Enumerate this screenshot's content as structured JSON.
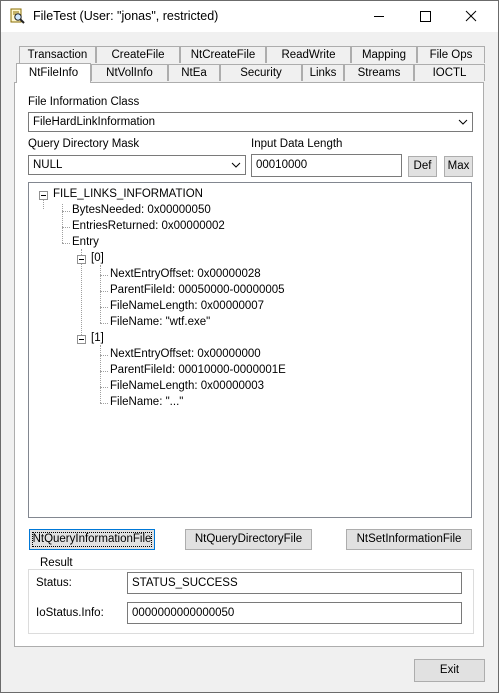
{
  "window": {
    "title": "FileTest (User: \"jonas\", restricted)",
    "icon": "magnifier-document-icon"
  },
  "tabs_row1": [
    "Transaction",
    "CreateFile",
    "NtCreateFile",
    "ReadWrite",
    "Mapping",
    "File Ops"
  ],
  "tabs_row2": [
    "NtFileInfo",
    "NtVolInfo",
    "NtEa",
    "Security",
    "Links",
    "Streams",
    "IOCTL"
  ],
  "active_tab": "NtFileInfo",
  "form": {
    "info_class_label": "File Information Class",
    "info_class_value": "FileHardLinkInformation",
    "dir_mask_label": "Query Directory Mask",
    "dir_mask_value": "NULL",
    "data_length_label": "Input Data Length",
    "data_length_value": "00010000",
    "def_label": "Def",
    "max_label": "Max"
  },
  "tree": {
    "root": "FILE_LINKS_INFORMATION",
    "bytes_needed": "BytesNeeded: 0x00000050",
    "entries_returned": "EntriesReturned: 0x00000002",
    "entry": "Entry",
    "item0": {
      "label": "[0]",
      "next_offset": "NextEntryOffset: 0x00000028",
      "parent_id": "ParentFileId: 00050000-00000005",
      "name_length": "FileNameLength: 0x00000007",
      "file_name": "FileName: \"wtf.exe\""
    },
    "item1": {
      "label": "[1]",
      "next_offset": "NextEntryOffset: 0x00000000",
      "parent_id": "ParentFileId: 00010000-0000001E",
      "name_length": "FileNameLength: 0x00000003",
      "file_name": "FileName: \"...\""
    }
  },
  "buttons": {
    "query_info": "NtQueryInformationFile",
    "query_dir": "NtQueryDirectoryFile",
    "set_info": "NtSetInformationFile",
    "exit": "Exit"
  },
  "result": {
    "group_title": "Result",
    "status_label": "Status:",
    "status_value": "STATUS_SUCCESS",
    "iostatus_label": "IoStatus.Info:",
    "iostatus_value": "0000000000000050"
  }
}
